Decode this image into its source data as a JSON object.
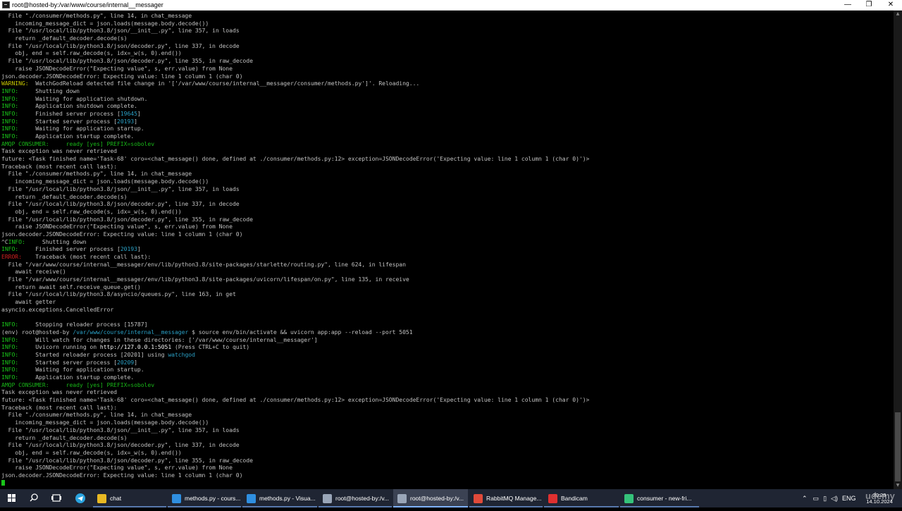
{
  "window": {
    "title": "root@hosted-by:/var/www/course/internal__messager",
    "min": "—",
    "max": "❐",
    "close": "✕"
  },
  "terminal": {
    "lines": [
      {
        "segs": [
          {
            "t": "  File \"./consumer/methods.py\", line 14, in chat_message"
          }
        ]
      },
      {
        "segs": [
          {
            "t": "    incoming_message_dict = json.loads(message.body.decode())"
          }
        ]
      },
      {
        "segs": [
          {
            "t": "  File \"/usr/local/lib/python3.8/json/__init__.py\", line 357, in loads"
          }
        ]
      },
      {
        "segs": [
          {
            "t": "    return _default_decoder.decode(s)"
          }
        ]
      },
      {
        "segs": [
          {
            "t": "  File \"/usr/local/lib/python3.8/json/decoder.py\", line 337, in decode"
          }
        ]
      },
      {
        "segs": [
          {
            "t": "    obj, end = self.raw_decode(s, idx=_w(s, 0).end())"
          }
        ]
      },
      {
        "segs": [
          {
            "t": "  File \"/usr/local/lib/python3.8/json/decoder.py\", line 355, in raw_decode"
          }
        ]
      },
      {
        "segs": [
          {
            "t": "    raise JSONDecodeError(\"Expecting value\", s, err.value) from None"
          }
        ]
      },
      {
        "segs": [
          {
            "t": "json.decoder.JSONDecodeError: Expecting value: line 1 column 1 (char 0)"
          }
        ]
      },
      {
        "segs": [
          {
            "t": "WARNING:",
            "c": "warn"
          },
          {
            "t": "  WatchGodReload detected file change in '['/var/www/course/internal__messager/consumer/methods.py']'. Reloading..."
          }
        ]
      },
      {
        "segs": [
          {
            "t": "INFO:",
            "c": "info"
          },
          {
            "t": "     Shutting down"
          }
        ]
      },
      {
        "segs": [
          {
            "t": "INFO:",
            "c": "info"
          },
          {
            "t": "     Waiting for application shutdown."
          }
        ]
      },
      {
        "segs": [
          {
            "t": "INFO:",
            "c": "info"
          },
          {
            "t": "     Application shutdown complete."
          }
        ]
      },
      {
        "segs": [
          {
            "t": "INFO:",
            "c": "info"
          },
          {
            "t": "     Finished server process ["
          },
          {
            "t": "19645",
            "c": "pid"
          },
          {
            "t": "]"
          }
        ]
      },
      {
        "segs": [
          {
            "t": "INFO:",
            "c": "info"
          },
          {
            "t": "     Started server process ["
          },
          {
            "t": "20193",
            "c": "pid"
          },
          {
            "t": "]"
          }
        ]
      },
      {
        "segs": [
          {
            "t": "INFO:",
            "c": "info"
          },
          {
            "t": "     Waiting for application startup."
          }
        ]
      },
      {
        "segs": [
          {
            "t": "INFO:",
            "c": "info"
          },
          {
            "t": "     Application startup complete."
          }
        ]
      },
      {
        "segs": [
          {
            "t": "AMQP CONSUMER:     ready [yes] PREFIX=sobolev",
            "c": "amqp"
          }
        ]
      },
      {
        "segs": [
          {
            "t": "Task exception was never retrieved"
          }
        ]
      },
      {
        "segs": [
          {
            "t": "future: <Task finished name='Task-68' coro=<chat_message() done, defined at ./consumer/methods.py:12> exception=JSONDecodeError('Expecting value: line 1 column 1 (char 0)')>"
          }
        ]
      },
      {
        "segs": [
          {
            "t": "Traceback (most recent call last):"
          }
        ]
      },
      {
        "segs": [
          {
            "t": "  File \"./consumer/methods.py\", line 14, in chat_message"
          }
        ]
      },
      {
        "segs": [
          {
            "t": "    incoming_message_dict = json.loads(message.body.decode())"
          }
        ]
      },
      {
        "segs": [
          {
            "t": "  File \"/usr/local/lib/python3.8/json/__init__.py\", line 357, in loads"
          }
        ]
      },
      {
        "segs": [
          {
            "t": "    return _default_decoder.decode(s)"
          }
        ]
      },
      {
        "segs": [
          {
            "t": "  File \"/usr/local/lib/python3.8/json/decoder.py\", line 337, in decode"
          }
        ]
      },
      {
        "segs": [
          {
            "t": "    obj, end = self.raw_decode(s, idx=_w(s, 0).end())"
          }
        ]
      },
      {
        "segs": [
          {
            "t": "  File \"/usr/local/lib/python3.8/json/decoder.py\", line 355, in raw_decode"
          }
        ]
      },
      {
        "segs": [
          {
            "t": "    raise JSONDecodeError(\"Expecting value\", s, err.value) from None"
          }
        ]
      },
      {
        "segs": [
          {
            "t": "json.decoder.JSONDecodeError: Expecting value: line 1 column 1 (char 0)"
          }
        ]
      },
      {
        "segs": [
          {
            "t": "^C"
          },
          {
            "t": "INFO:",
            "c": "info"
          },
          {
            "t": "     Shutting down"
          }
        ]
      },
      {
        "segs": [
          {
            "t": "INFO:",
            "c": "info"
          },
          {
            "t": "     Finished server process ["
          },
          {
            "t": "20193",
            "c": "pid"
          },
          {
            "t": "]"
          }
        ]
      },
      {
        "segs": [
          {
            "t": "ERROR:",
            "c": "err"
          },
          {
            "t": "    Traceback (most recent call last):"
          }
        ]
      },
      {
        "segs": [
          {
            "t": "  File \"/var/www/course/internal__messager/env/lib/python3.8/site-packages/starlette/routing.py\", line 624, in lifespan"
          }
        ]
      },
      {
        "segs": [
          {
            "t": "    await receive()"
          }
        ]
      },
      {
        "segs": [
          {
            "t": "  File \"/var/www/course/internal__messager/env/lib/python3.8/site-packages/uvicorn/lifespan/on.py\", line 135, in receive"
          }
        ]
      },
      {
        "segs": [
          {
            "t": "    return await self.receive_queue.get()"
          }
        ]
      },
      {
        "segs": [
          {
            "t": "  File \"/usr/local/lib/python3.8/asyncio/queues.py\", line 163, in get"
          }
        ]
      },
      {
        "segs": [
          {
            "t": "    await getter"
          }
        ]
      },
      {
        "segs": [
          {
            "t": "asyncio.exceptions.CancelledError"
          }
        ]
      },
      {
        "segs": [
          {
            "t": ""
          }
        ]
      },
      {
        "segs": [
          {
            "t": "INFO:",
            "c": "info"
          },
          {
            "t": "     Stopping reloader process [15787]"
          }
        ]
      },
      {
        "segs": [
          {
            "t": "(env) root@hosted-by "
          },
          {
            "t": "/var/www/course/internal__messager",
            "c": "path-blue"
          },
          {
            "t": " $ source env/bin/activate && uvicorn app:app --reload --port 5051"
          }
        ]
      },
      {
        "segs": [
          {
            "t": "INFO:",
            "c": "info"
          },
          {
            "t": "     Will watch for changes in these directories: ['/var/www/course/internal__messager']"
          }
        ]
      },
      {
        "segs": [
          {
            "t": "INFO:",
            "c": "info"
          },
          {
            "t": "     Uvicorn running on "
          },
          {
            "t": "http://127.0.0.1:5051",
            "c": "bold"
          },
          {
            "t": " (Press CTRL+C to quit)"
          }
        ]
      },
      {
        "segs": [
          {
            "t": "INFO:",
            "c": "info"
          },
          {
            "t": "     Started reloader process [20201] using "
          },
          {
            "t": "watchgod",
            "c": "pid"
          }
        ]
      },
      {
        "segs": [
          {
            "t": "INFO:",
            "c": "info"
          },
          {
            "t": "     Started server process ["
          },
          {
            "t": "20209",
            "c": "pid"
          },
          {
            "t": "]"
          }
        ]
      },
      {
        "segs": [
          {
            "t": "INFO:",
            "c": "info"
          },
          {
            "t": "     Waiting for application startup."
          }
        ]
      },
      {
        "segs": [
          {
            "t": "INFO:",
            "c": "info"
          },
          {
            "t": "     Application startup complete."
          }
        ]
      },
      {
        "segs": [
          {
            "t": "AMQP CONSUMER:     ready [yes] PREFIX=sobolev",
            "c": "amqp"
          }
        ]
      },
      {
        "segs": [
          {
            "t": "Task exception was never retrieved"
          }
        ]
      },
      {
        "segs": [
          {
            "t": "future: <Task finished name='Task-68' coro=<chat_message() done, defined at ./consumer/methods.py:12> exception=JSONDecodeError('Expecting value: line 1 column 1 (char 0)')>"
          }
        ]
      },
      {
        "segs": [
          {
            "t": "Traceback (most recent call last):"
          }
        ]
      },
      {
        "segs": [
          {
            "t": "  File \"./consumer/methods.py\", line 14, in chat_message"
          }
        ]
      },
      {
        "segs": [
          {
            "t": "    incoming_message_dict = json.loads(message.body.decode())"
          }
        ]
      },
      {
        "segs": [
          {
            "t": "  File \"/usr/local/lib/python3.8/json/__init__.py\", line 357, in loads"
          }
        ]
      },
      {
        "segs": [
          {
            "t": "    return _default_decoder.decode(s)"
          }
        ]
      },
      {
        "segs": [
          {
            "t": "  File \"/usr/local/lib/python3.8/json/decoder.py\", line 337, in decode"
          }
        ]
      },
      {
        "segs": [
          {
            "t": "    obj, end = self.raw_decode(s, idx=_w(s, 0).end())"
          }
        ]
      },
      {
        "segs": [
          {
            "t": "  File \"/usr/local/lib/python3.8/json/decoder.py\", line 355, in raw_decode"
          }
        ]
      },
      {
        "segs": [
          {
            "t": "    raise JSONDecodeError(\"Expecting value\", s, err.value) from None"
          }
        ]
      },
      {
        "segs": [
          {
            "t": "json.decoder.JSONDecodeError: Expecting value: line 1 column 1 (char 0)"
          }
        ]
      }
    ]
  },
  "taskbar": {
    "apps": [
      {
        "label": "chat",
        "icon": "folder-icon",
        "color": "#e8b923",
        "active": false
      },
      {
        "label": "methods.py - cours...",
        "icon": "vscode-icon",
        "color": "#2f8fe0",
        "active": false
      },
      {
        "label": "methods.py - Visua...",
        "icon": "vscode-icon",
        "color": "#2f8fe0",
        "active": false
      },
      {
        "label": "root@hosted-by:/v...",
        "icon": "terminal-icon",
        "color": "#9aa6b8",
        "active": false
      },
      {
        "label": "root@hosted-by:/v...",
        "icon": "terminal-icon",
        "color": "#9aa6b8",
        "active": true
      },
      {
        "label": "RabbitMQ Manage...",
        "icon": "chrome-icon",
        "color": "#e04a3a",
        "active": false
      },
      {
        "label": "Bandicam",
        "icon": "bandicam-icon",
        "color": "#e03030",
        "active": false
      },
      {
        "label": "consumer - new-fri...",
        "icon": "pycharm-icon",
        "color": "#35c27a",
        "active": false
      }
    ],
    "tray": {
      "lang": "ENG",
      "time": "20:29",
      "date": "14.10.2024"
    },
    "watermark": "udemy"
  }
}
